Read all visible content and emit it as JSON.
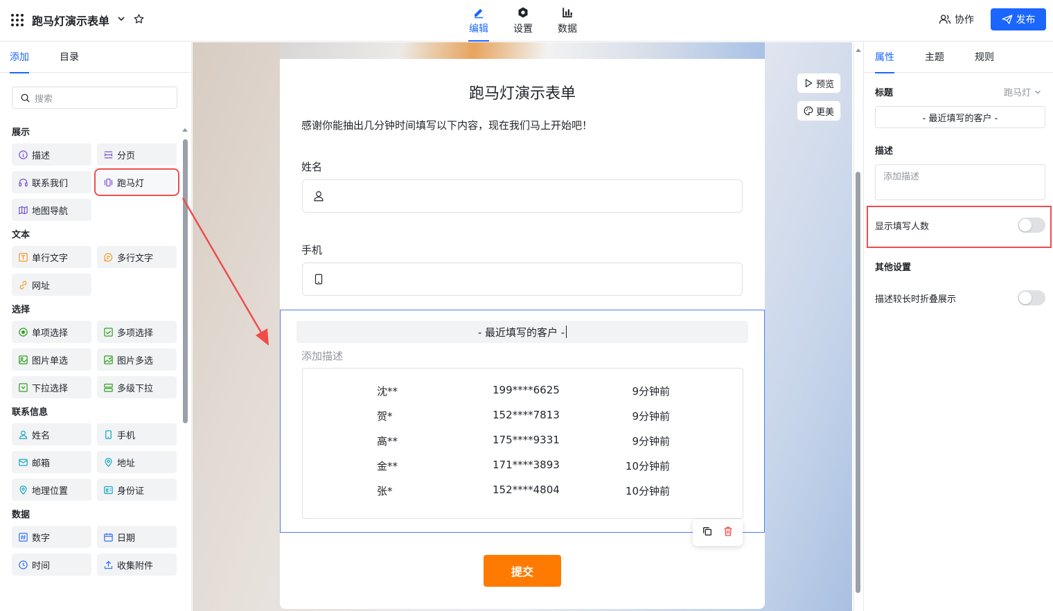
{
  "header": {
    "title": "跑马灯演示表单",
    "tabs": [
      {
        "label": "编辑",
        "icon": "edit-icon",
        "active": true
      },
      {
        "label": "设置",
        "icon": "settings-icon",
        "active": false
      },
      {
        "label": "数据",
        "icon": "bar-chart-icon",
        "active": false
      }
    ],
    "collab_label": "协作",
    "publish_label": "发布"
  },
  "left_panel": {
    "tabs": [
      {
        "label": "添加",
        "active": true
      },
      {
        "label": "目录",
        "active": false
      }
    ],
    "search_placeholder": "搜索",
    "sections": [
      {
        "title": "展示",
        "items": [
          {
            "label": "描述",
            "icon": "info-icon",
            "color": "#7b56d6"
          },
          {
            "label": "分页",
            "icon": "pagination-icon",
            "color": "#7b56d6"
          },
          {
            "label": "联系我们",
            "icon": "headset-icon",
            "color": "#7b56d6"
          },
          {
            "label": "跑马灯",
            "icon": "marquee-icon",
            "color": "#7b56d6",
            "highlighted": true
          },
          {
            "label": "地图导航",
            "icon": "map-icon",
            "color": "#7b56d6"
          }
        ]
      },
      {
        "title": "文本",
        "items": [
          {
            "label": "单行文字",
            "icon": "text-icon",
            "color": "#f59a23"
          },
          {
            "label": "多行文字",
            "icon": "comment-icon",
            "color": "#f59a23"
          },
          {
            "label": "网址",
            "icon": "link-icon",
            "color": "#f59a23"
          }
        ]
      },
      {
        "title": "选择",
        "items": [
          {
            "label": "单项选择",
            "icon": "radio-icon",
            "color": "#2ea121"
          },
          {
            "label": "多项选择",
            "icon": "checkbox-icon",
            "color": "#2ea121"
          },
          {
            "label": "图片单选",
            "icon": "image-icon",
            "color": "#2ea121"
          },
          {
            "label": "图片多选",
            "icon": "image-multi-icon",
            "color": "#2ea121"
          },
          {
            "label": "下拉选择",
            "icon": "dropdown-icon",
            "color": "#2ea121"
          },
          {
            "label": "多级下拉",
            "icon": "cascade-icon",
            "color": "#2ea121"
          }
        ]
      },
      {
        "title": "联系信息",
        "items": [
          {
            "label": "姓名",
            "icon": "user-icon",
            "color": "#14a9c4"
          },
          {
            "label": "手机",
            "icon": "phone-icon",
            "color": "#14a9c4"
          },
          {
            "label": "邮箱",
            "icon": "mail-icon",
            "color": "#14a9c4"
          },
          {
            "label": "地址",
            "icon": "location-icon",
            "color": "#14a9c4"
          },
          {
            "label": "地理位置",
            "icon": "pin-icon",
            "color": "#14a9c4"
          },
          {
            "label": "身份证",
            "icon": "id-card-icon",
            "color": "#14a9c4"
          }
        ]
      },
      {
        "title": "数据",
        "items": [
          {
            "label": "数字",
            "icon": "number-icon",
            "color": "#3370ff"
          },
          {
            "label": "日期",
            "icon": "calendar-icon",
            "color": "#3370ff"
          },
          {
            "label": "时间",
            "icon": "clock-icon",
            "color": "#3370ff"
          },
          {
            "label": "收集附件",
            "icon": "upload-icon",
            "color": "#3370ff"
          }
        ]
      }
    ]
  },
  "form": {
    "title": "跑马灯演示表单",
    "description": "感谢你能抽出几分钟时间填写以下内容，现在我们马上开始吧！",
    "fields": [
      {
        "label": "姓名",
        "icon": "user-icon"
      },
      {
        "label": "手机",
        "icon": "phone-icon"
      }
    ],
    "marquee": {
      "title": "- 最近填写的客户 -",
      "description_placeholder": "添加描述",
      "rows": [
        {
          "name": "沈**",
          "phone": "199****6625",
          "time": "9分钟前"
        },
        {
          "name": "贺*",
          "phone": "152****7813",
          "time": "9分钟前"
        },
        {
          "name": "高**",
          "phone": "175****9331",
          "time": "9分钟前"
        },
        {
          "name": "金**",
          "phone": "171****3893",
          "time": "10分钟前"
        },
        {
          "name": "张*",
          "phone": "152****4804",
          "time": "10分钟前"
        }
      ]
    },
    "submit_label": "提交"
  },
  "canvas_buttons": {
    "preview_label": "预览",
    "beautify_label": "更美"
  },
  "right_panel": {
    "tabs": [
      {
        "label": "属性",
        "active": true
      },
      {
        "label": "主题",
        "active": false
      },
      {
        "label": "规则",
        "active": false
      }
    ],
    "title_label": "标题",
    "component_type": "跑马灯",
    "title_value": "- 最近填写的客户 -",
    "desc_label": "描述",
    "desc_placeholder": "添加描述",
    "show_count_label": "显示填写人数",
    "show_count_on": false,
    "other_label": "其他设置",
    "collapse_label": "描述较长时折叠展示",
    "collapse_on": false
  },
  "colors": {
    "accent": "#1a66ff",
    "submit": "#ff7a00",
    "highlight": "#f04b4b"
  }
}
